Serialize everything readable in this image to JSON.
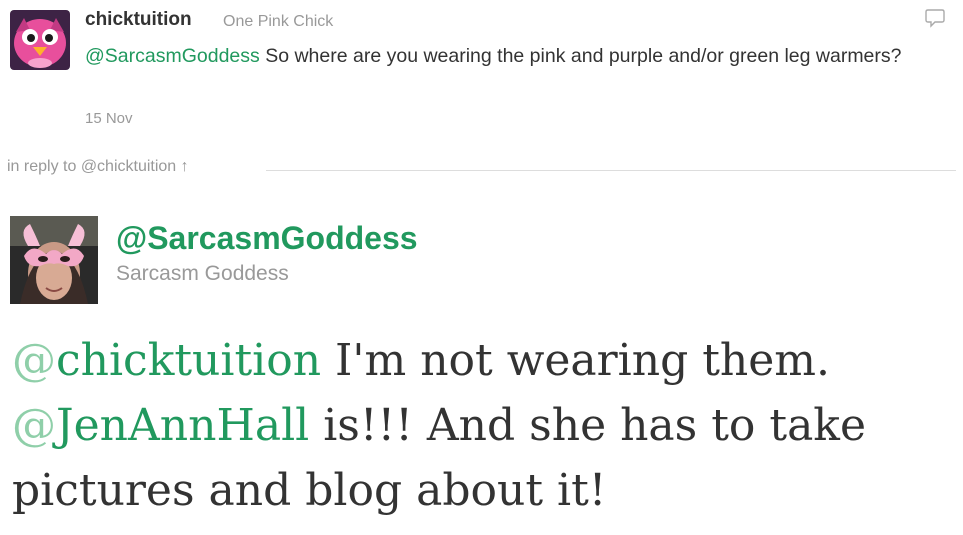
{
  "reply_tweet": {
    "username": "chicktuition",
    "full_name": "One Pink Chick",
    "mention": "@SarcasmGoddess",
    "text": " So where are you wearing the pink and purple and/or green leg warmers?",
    "date": "15 Nov",
    "icon": "reply-bubble-icon"
  },
  "in_reply_to": {
    "label": "in reply to @chicktuition ↑"
  },
  "main_tweet": {
    "handle": "@SarcasmGoddess",
    "full_name": "Sarcasm Goddess",
    "mention1_at": "@",
    "mention1_name": "chicktuition",
    "text1": " I'm not wearing them. ",
    "mention2_at": "@",
    "mention2_name": "JenAnnHall",
    "text2": " is!!! And she has to take pictures and blog about it!"
  },
  "colors": {
    "link_green": "#21995e",
    "muted_gray": "#999999",
    "text": "#333333",
    "avatar_pink": "#e84f9c"
  }
}
